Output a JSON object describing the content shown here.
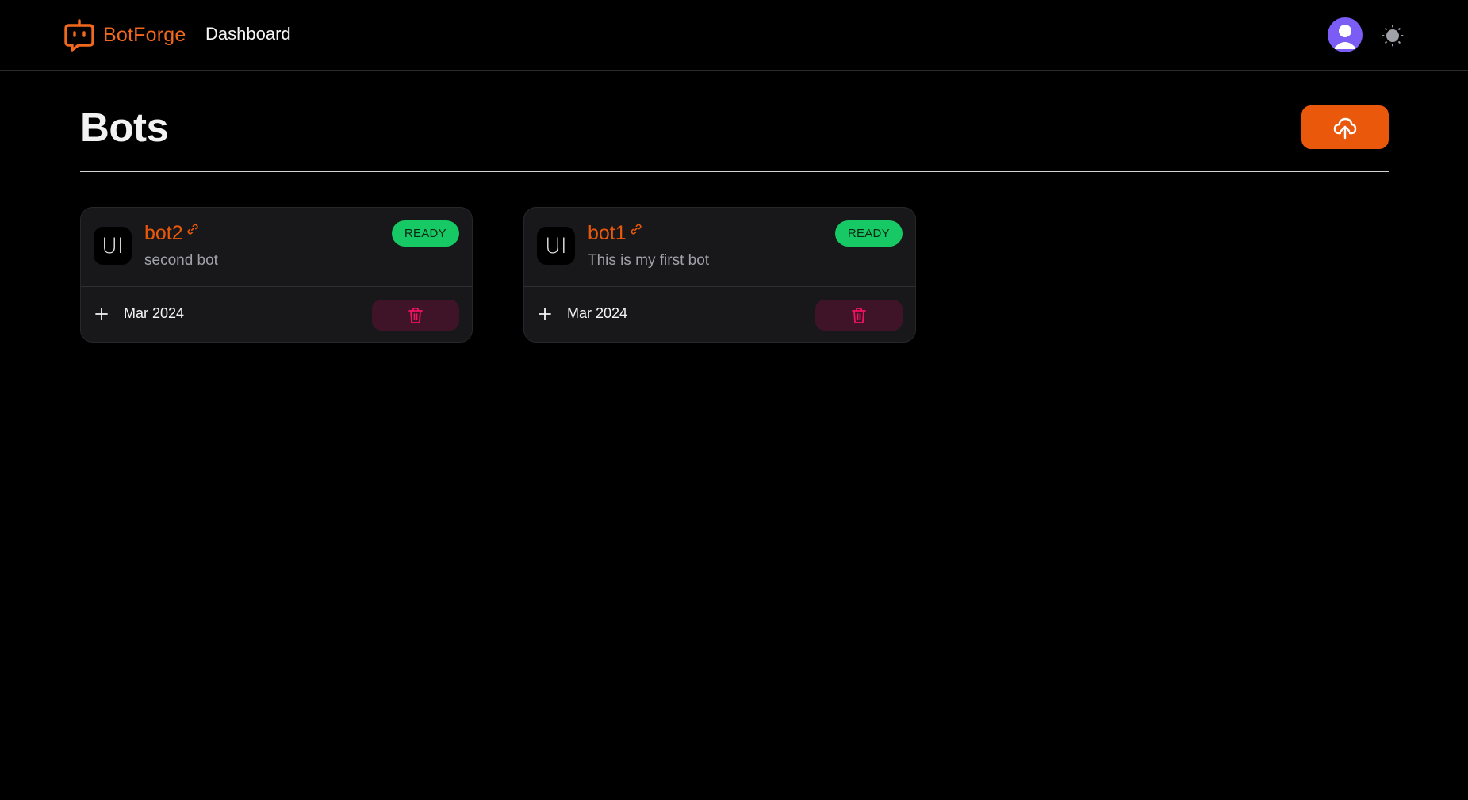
{
  "app": {
    "brand_name": "BotForge",
    "brand_color": "#f2691e"
  },
  "nav": {
    "dashboard_label": "Dashboard"
  },
  "header": {
    "title": "Bots",
    "upload_icon": "cloud-upload-icon",
    "accent_color": "#ea580c"
  },
  "bots": [
    {
      "avatar_text": "UI",
      "name": "bot2",
      "description": "second bot",
      "status": "READY",
      "date": "Mar 2024"
    },
    {
      "avatar_text": "UI",
      "name": "bot1",
      "description": "This is my first bot",
      "status": "READY",
      "date": "Mar 2024"
    }
  ],
  "colors": {
    "status_ready": "#17c964",
    "delete_bg": "#3f1428",
    "delete_icon": "#f31260",
    "avatar_bg": "#7b5cf5"
  }
}
